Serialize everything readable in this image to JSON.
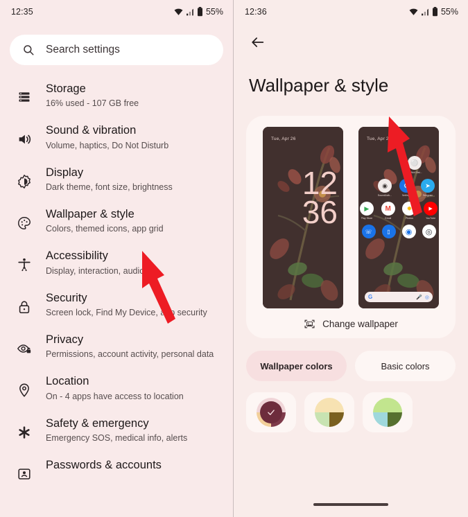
{
  "left_panel": {
    "status": {
      "time": "12:35",
      "battery": "55%",
      "icons": [
        "wifi-icon",
        "signal-icon",
        "battery-icon"
      ]
    },
    "search": {
      "placeholder": "Search settings",
      "icon": "search-icon"
    },
    "items": [
      {
        "icon": "storage-icon",
        "title": "Storage",
        "subtitle": "16% used - 107 GB free"
      },
      {
        "icon": "volume-icon",
        "title": "Sound & vibration",
        "subtitle": "Volume, haptics, Do Not Disturb"
      },
      {
        "icon": "brightness-icon",
        "title": "Display",
        "subtitle": "Dark theme, font size, brightness"
      },
      {
        "icon": "palette-icon",
        "title": "Wallpaper & style",
        "subtitle": "Colors, themed icons, app grid"
      },
      {
        "icon": "accessibility-icon",
        "title": "Accessibility",
        "subtitle": "Display, interaction, audio"
      },
      {
        "icon": "lock-icon",
        "title": "Security",
        "subtitle": "Screen lock, Find My Device, app security"
      },
      {
        "icon": "eye-lock-icon",
        "title": "Privacy",
        "subtitle": "Permissions, account activity, personal data"
      },
      {
        "icon": "location-pin-icon",
        "title": "Location",
        "subtitle": "On - 4 apps have access to location"
      },
      {
        "icon": "asterisk-icon",
        "title": "Safety & emergency",
        "subtitle": "Emergency SOS, medical info, alerts"
      },
      {
        "icon": "account-card-icon",
        "title": "Passwords & accounts",
        "subtitle": ""
      }
    ]
  },
  "right_panel": {
    "status": {
      "time": "12:36",
      "battery": "55%"
    },
    "back_icon": "back-arrow-icon",
    "title": "Wallpaper & style",
    "preview": {
      "lock": {
        "date": "Tue, Apr 26",
        "hour": "12",
        "minute": "36"
      },
      "home": {
        "date": "Tue, Apr 26",
        "rows": [
          [
            {
              "label": "Do Not Dist...",
              "icon": "do-not-disturb-icon",
              "color": "#f2eceb",
              "glyph": "○"
            }
          ],
          [
            {
              "label": "Sound&vib...",
              "icon": "sound-vibration-icon",
              "color": "#f2eceb",
              "glyph": "●"
            },
            {
              "label": "Settings",
              "icon": "settings-icon",
              "color": "#1a73e8",
              "glyph": "⚙"
            },
            {
              "label": "Telegram",
              "icon": "telegram-icon",
              "color": "#2aabee",
              "glyph": "➤"
            }
          ],
          [
            {
              "label": "Play Store",
              "icon": "play-store-icon",
              "color": "#ffffff",
              "glyph": "▶"
            },
            {
              "label": "Gmail",
              "icon": "gmail-icon",
              "color": "#ffffff",
              "glyph": "M"
            },
            {
              "label": "Photos",
              "icon": "photos-icon",
              "color": "#ffffff",
              "glyph": "✹"
            },
            {
              "label": "YouTube",
              "icon": "youtube-icon",
              "color": "#ff0000",
              "glyph": "▶"
            }
          ]
        ],
        "dock": [
          {
            "label": "Phone",
            "icon": "phone-icon",
            "color": "#1a73e8",
            "glyph": "✆"
          },
          {
            "label": "Messages",
            "icon": "messages-icon",
            "color": "#1a73e8",
            "glyph": "▭"
          },
          {
            "label": "Chrome",
            "icon": "chrome-icon",
            "color": "#ffffff",
            "glyph": "◉"
          },
          {
            "label": "Camera",
            "icon": "camera-icon",
            "color": "#ffffff",
            "glyph": "◎"
          }
        ],
        "search_pill": {
          "left_icon": "google-g-icon",
          "mic_icon": "mic-icon",
          "lens_icon": "lens-icon"
        }
      }
    },
    "change_wallpaper": {
      "label": "Change wallpaper",
      "icon": "image-crop-icon"
    },
    "tabs": [
      {
        "label": "Wallpaper colors",
        "selected": true
      },
      {
        "label": "Basic colors",
        "selected": false
      }
    ],
    "swatches": [
      {
        "name": "swatch-1",
        "selected": true,
        "colors": [
          "#f0d5d8",
          "#f0d5d8",
          "#f2cf9a",
          "#7e3a4a"
        ],
        "overlay": "#6d2c3c",
        "check_icon": "check-icon"
      },
      {
        "name": "swatch-2",
        "selected": false,
        "colors": [
          "#f7e2b2",
          "#f7e2b2",
          "#c8e3b2",
          "#7a6020"
        ]
      },
      {
        "name": "swatch-3",
        "selected": false,
        "colors": [
          "#c2e58e",
          "#c2e58e",
          "#9fd8dc",
          "#56702f"
        ]
      }
    ]
  },
  "annotations": [
    {
      "name": "arrow-to-wallpaper-style",
      "color": "#ed1c24"
    },
    {
      "name": "arrow-to-change-wallpaper",
      "color": "#ed1c24"
    }
  ]
}
